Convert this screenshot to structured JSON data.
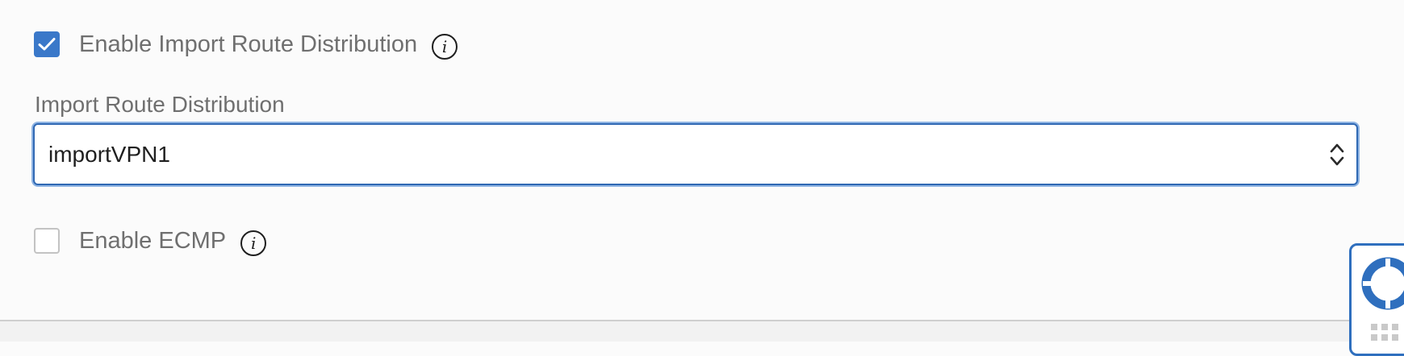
{
  "import_route_checkbox": {
    "label": "Enable Import Route Distribution",
    "checked": true,
    "info_glyph": "i"
  },
  "import_route_select": {
    "label": "Import Route Distribution",
    "value": "importVPN1"
  },
  "ecmp_checkbox": {
    "label": "Enable ECMP",
    "checked": false,
    "info_glyph": "i"
  },
  "icons": {
    "checkmark": "checkmark-icon",
    "info": "info-icon",
    "select_arrows": "chevron-up-down-icon",
    "help": "lifebuoy-icon",
    "grip": "drag-grip-icon"
  },
  "colors": {
    "accent": "#3a78c9",
    "focus_border": "#2f68b3",
    "label_text": "#6f6f6f",
    "value_text": "#1f1f1f"
  }
}
